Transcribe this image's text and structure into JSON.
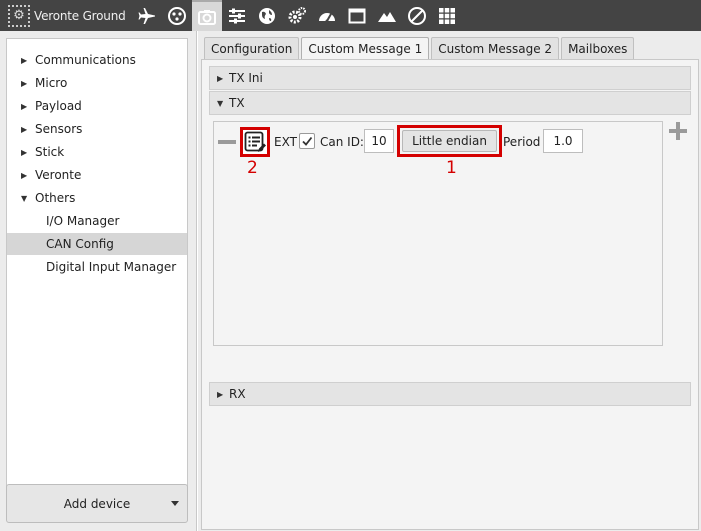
{
  "app": {
    "title": "Veronte Ground"
  },
  "toolbar": {
    "icons": [
      "airplane-icon",
      "dots-circle-icon",
      "camera-icon",
      "sliders-icon",
      "globe-icon",
      "gears-icon",
      "gauge-icon",
      "window-icon",
      "mountain-icon",
      "no-entry-icon",
      "grid-icon"
    ],
    "active": "camera-icon"
  },
  "sidebar": {
    "items": [
      {
        "label": "Communications",
        "expanded": false
      },
      {
        "label": "Micro",
        "expanded": false
      },
      {
        "label": "Payload",
        "expanded": false
      },
      {
        "label": "Sensors",
        "expanded": false
      },
      {
        "label": "Stick",
        "expanded": false
      },
      {
        "label": "Veronte",
        "expanded": false
      },
      {
        "label": "Others",
        "expanded": true
      }
    ],
    "children": [
      {
        "label": "I/O Manager"
      },
      {
        "label": "CAN Config",
        "selected": true
      },
      {
        "label": "Digital Input Manager"
      }
    ],
    "add_device_label": "Add device"
  },
  "tabs": [
    {
      "label": "Configuration"
    },
    {
      "label": "Custom Message 1",
      "active": true
    },
    {
      "label": "Custom Message 2"
    },
    {
      "label": "Mailboxes"
    }
  ],
  "sections": {
    "tx_ini": "TX Ini",
    "tx": "TX",
    "rx": "RX"
  },
  "tx_row": {
    "ext_label": "EXT",
    "ext_checked": true,
    "can_id_label": "Can ID:",
    "can_id_value": "10",
    "endian_label": "Little endian",
    "period_label": "Period",
    "period_value": "1.0"
  },
  "annotations": {
    "first": "1",
    "second": "2"
  },
  "colors": {
    "annotation": "#d40000",
    "topbar": "#444444"
  }
}
